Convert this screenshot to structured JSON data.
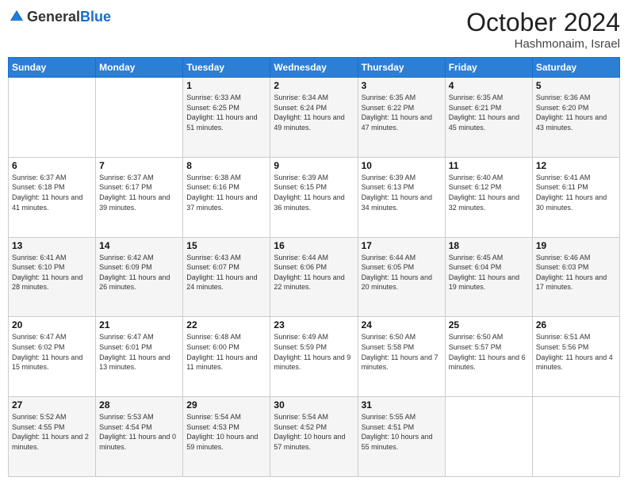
{
  "header": {
    "logo_general": "General",
    "logo_blue": "Blue",
    "month": "October 2024",
    "location": "Hashmonaim, Israel"
  },
  "weekdays": [
    "Sunday",
    "Monday",
    "Tuesday",
    "Wednesday",
    "Thursday",
    "Friday",
    "Saturday"
  ],
  "weeks": [
    [
      {
        "day": "",
        "info": ""
      },
      {
        "day": "",
        "info": ""
      },
      {
        "day": "1",
        "info": "Sunrise: 6:33 AM\nSunset: 6:25 PM\nDaylight: 11 hours and 51 minutes."
      },
      {
        "day": "2",
        "info": "Sunrise: 6:34 AM\nSunset: 6:24 PM\nDaylight: 11 hours and 49 minutes."
      },
      {
        "day": "3",
        "info": "Sunrise: 6:35 AM\nSunset: 6:22 PM\nDaylight: 11 hours and 47 minutes."
      },
      {
        "day": "4",
        "info": "Sunrise: 6:35 AM\nSunset: 6:21 PM\nDaylight: 11 hours and 45 minutes."
      },
      {
        "day": "5",
        "info": "Sunrise: 6:36 AM\nSunset: 6:20 PM\nDaylight: 11 hours and 43 minutes."
      }
    ],
    [
      {
        "day": "6",
        "info": "Sunrise: 6:37 AM\nSunset: 6:18 PM\nDaylight: 11 hours and 41 minutes."
      },
      {
        "day": "7",
        "info": "Sunrise: 6:37 AM\nSunset: 6:17 PM\nDaylight: 11 hours and 39 minutes."
      },
      {
        "day": "8",
        "info": "Sunrise: 6:38 AM\nSunset: 6:16 PM\nDaylight: 11 hours and 37 minutes."
      },
      {
        "day": "9",
        "info": "Sunrise: 6:39 AM\nSunset: 6:15 PM\nDaylight: 11 hours and 36 minutes."
      },
      {
        "day": "10",
        "info": "Sunrise: 6:39 AM\nSunset: 6:13 PM\nDaylight: 11 hours and 34 minutes."
      },
      {
        "day": "11",
        "info": "Sunrise: 6:40 AM\nSunset: 6:12 PM\nDaylight: 11 hours and 32 minutes."
      },
      {
        "day": "12",
        "info": "Sunrise: 6:41 AM\nSunset: 6:11 PM\nDaylight: 11 hours and 30 minutes."
      }
    ],
    [
      {
        "day": "13",
        "info": "Sunrise: 6:41 AM\nSunset: 6:10 PM\nDaylight: 11 hours and 28 minutes."
      },
      {
        "day": "14",
        "info": "Sunrise: 6:42 AM\nSunset: 6:09 PM\nDaylight: 11 hours and 26 minutes."
      },
      {
        "day": "15",
        "info": "Sunrise: 6:43 AM\nSunset: 6:07 PM\nDaylight: 11 hours and 24 minutes."
      },
      {
        "day": "16",
        "info": "Sunrise: 6:44 AM\nSunset: 6:06 PM\nDaylight: 11 hours and 22 minutes."
      },
      {
        "day": "17",
        "info": "Sunrise: 6:44 AM\nSunset: 6:05 PM\nDaylight: 11 hours and 20 minutes."
      },
      {
        "day": "18",
        "info": "Sunrise: 6:45 AM\nSunset: 6:04 PM\nDaylight: 11 hours and 19 minutes."
      },
      {
        "day": "19",
        "info": "Sunrise: 6:46 AM\nSunset: 6:03 PM\nDaylight: 11 hours and 17 minutes."
      }
    ],
    [
      {
        "day": "20",
        "info": "Sunrise: 6:47 AM\nSunset: 6:02 PM\nDaylight: 11 hours and 15 minutes."
      },
      {
        "day": "21",
        "info": "Sunrise: 6:47 AM\nSunset: 6:01 PM\nDaylight: 11 hours and 13 minutes."
      },
      {
        "day": "22",
        "info": "Sunrise: 6:48 AM\nSunset: 6:00 PM\nDaylight: 11 hours and 11 minutes."
      },
      {
        "day": "23",
        "info": "Sunrise: 6:49 AM\nSunset: 5:59 PM\nDaylight: 11 hours and 9 minutes."
      },
      {
        "day": "24",
        "info": "Sunrise: 6:50 AM\nSunset: 5:58 PM\nDaylight: 11 hours and 7 minutes."
      },
      {
        "day": "25",
        "info": "Sunrise: 6:50 AM\nSunset: 5:57 PM\nDaylight: 11 hours and 6 minutes."
      },
      {
        "day": "26",
        "info": "Sunrise: 6:51 AM\nSunset: 5:56 PM\nDaylight: 11 hours and 4 minutes."
      }
    ],
    [
      {
        "day": "27",
        "info": "Sunrise: 5:52 AM\nSunset: 4:55 PM\nDaylight: 11 hours and 2 minutes."
      },
      {
        "day": "28",
        "info": "Sunrise: 5:53 AM\nSunset: 4:54 PM\nDaylight: 11 hours and 0 minutes."
      },
      {
        "day": "29",
        "info": "Sunrise: 5:54 AM\nSunset: 4:53 PM\nDaylight: 10 hours and 59 minutes."
      },
      {
        "day": "30",
        "info": "Sunrise: 5:54 AM\nSunset: 4:52 PM\nDaylight: 10 hours and 57 minutes."
      },
      {
        "day": "31",
        "info": "Sunrise: 5:55 AM\nSunset: 4:51 PM\nDaylight: 10 hours and 55 minutes."
      },
      {
        "day": "",
        "info": ""
      },
      {
        "day": "",
        "info": ""
      }
    ]
  ]
}
